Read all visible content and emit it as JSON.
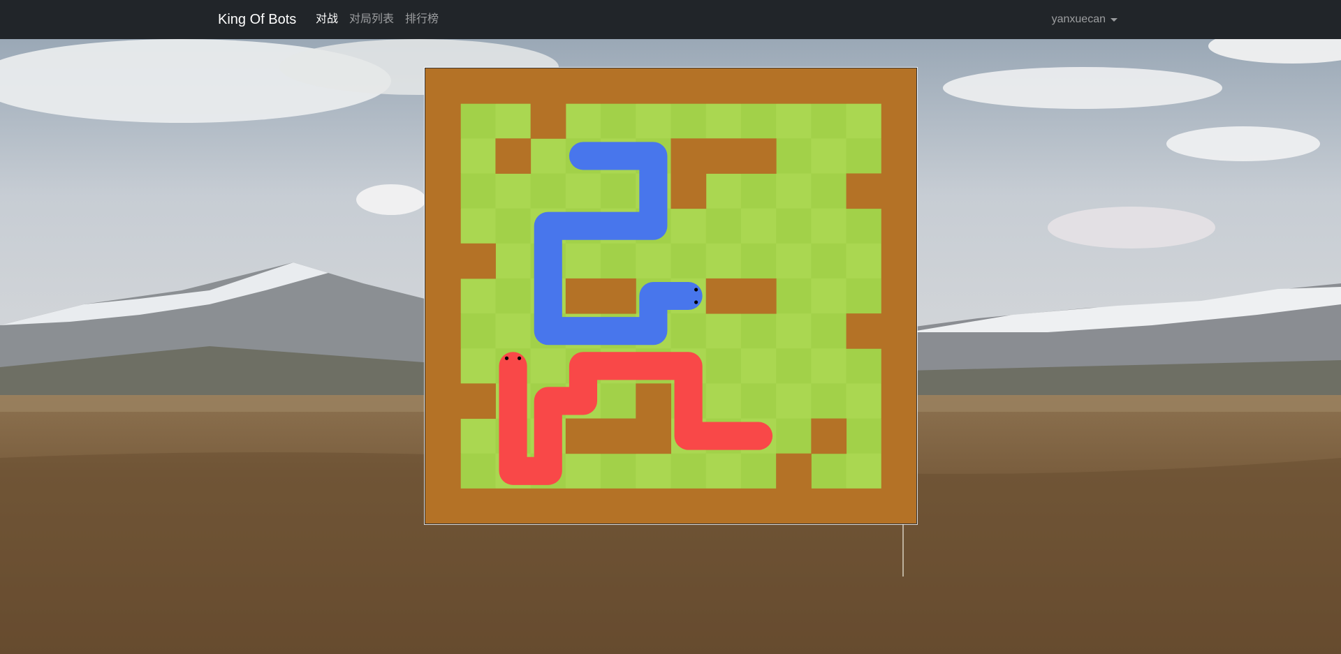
{
  "app": {
    "brand": "King Of Bots"
  },
  "nav": {
    "links": [
      {
        "label": "对战",
        "active": true
      },
      {
        "label": "对局列表",
        "active": false
      },
      {
        "label": "排行榜",
        "active": false
      }
    ],
    "user": {
      "name": "yanxuecan"
    }
  },
  "game": {
    "rows": 13,
    "cols": 14,
    "colors": {
      "wall": "#b47226",
      "grass_even": "#a2d149",
      "grass_odd": "#aad751",
      "snake_a": "#4876ec",
      "snake_b": "#f94848",
      "eye": "#000000"
    },
    "walls": [
      [
        0,
        0
      ],
      [
        0,
        1
      ],
      [
        0,
        2
      ],
      [
        0,
        3
      ],
      [
        0,
        4
      ],
      [
        0,
        5
      ],
      [
        0,
        6
      ],
      [
        0,
        7
      ],
      [
        0,
        8
      ],
      [
        0,
        9
      ],
      [
        0,
        10
      ],
      [
        0,
        11
      ],
      [
        0,
        12
      ],
      [
        0,
        13
      ],
      [
        12,
        0
      ],
      [
        12,
        1
      ],
      [
        12,
        2
      ],
      [
        12,
        3
      ],
      [
        12,
        4
      ],
      [
        12,
        5
      ],
      [
        12,
        6
      ],
      [
        12,
        7
      ],
      [
        12,
        8
      ],
      [
        12,
        9
      ],
      [
        12,
        10
      ],
      [
        12,
        11
      ],
      [
        12,
        12
      ],
      [
        12,
        13
      ],
      [
        1,
        0
      ],
      [
        2,
        0
      ],
      [
        3,
        0
      ],
      [
        4,
        0
      ],
      [
        5,
        0
      ],
      [
        6,
        0
      ],
      [
        7,
        0
      ],
      [
        8,
        0
      ],
      [
        9,
        0
      ],
      [
        10,
        0
      ],
      [
        11,
        0
      ],
      [
        1,
        13
      ],
      [
        2,
        13
      ],
      [
        3,
        13
      ],
      [
        4,
        13
      ],
      [
        5,
        13
      ],
      [
        6,
        13
      ],
      [
        7,
        13
      ],
      [
        8,
        13
      ],
      [
        9,
        13
      ],
      [
        10,
        13
      ],
      [
        11,
        13
      ],
      [
        1,
        3
      ],
      [
        2,
        2
      ],
      [
        2,
        7
      ],
      [
        2,
        8
      ],
      [
        2,
        9
      ],
      [
        3,
        7
      ],
      [
        3,
        12
      ],
      [
        5,
        1
      ],
      [
        6,
        4
      ],
      [
        6,
        5
      ],
      [
        6,
        8
      ],
      [
        6,
        9
      ],
      [
        7,
        12
      ],
      [
        9,
        1
      ],
      [
        9,
        6
      ],
      [
        10,
        4
      ],
      [
        10,
        5
      ],
      [
        10,
        6
      ],
      [
        10,
        11
      ],
      [
        11,
        10
      ]
    ],
    "snakes": [
      {
        "id": "blue",
        "color_key": "snake_a",
        "body": [
          [
            6,
            7
          ],
          [
            6,
            6
          ],
          [
            7,
            6
          ],
          [
            7,
            5
          ],
          [
            7,
            4
          ],
          [
            7,
            3
          ],
          [
            6,
            3
          ],
          [
            5,
            3
          ],
          [
            4,
            3
          ],
          [
            4,
            4
          ],
          [
            4,
            5
          ],
          [
            4,
            6
          ],
          [
            3,
            6
          ],
          [
            2,
            6
          ],
          [
            2,
            5
          ],
          [
            2,
            4
          ]
        ],
        "eyes": "right"
      },
      {
        "id": "red",
        "color_key": "snake_b",
        "body": [
          [
            8,
            2
          ],
          [
            9,
            2
          ],
          [
            10,
            2
          ],
          [
            11,
            2
          ],
          [
            11,
            3
          ],
          [
            10,
            3
          ],
          [
            9,
            3
          ],
          [
            9,
            4
          ],
          [
            8,
            4
          ],
          [
            8,
            5
          ],
          [
            8,
            6
          ],
          [
            8,
            7
          ],
          [
            9,
            7
          ],
          [
            10,
            7
          ],
          [
            10,
            8
          ],
          [
            10,
            9
          ]
        ],
        "eyes": "up"
      }
    ]
  }
}
